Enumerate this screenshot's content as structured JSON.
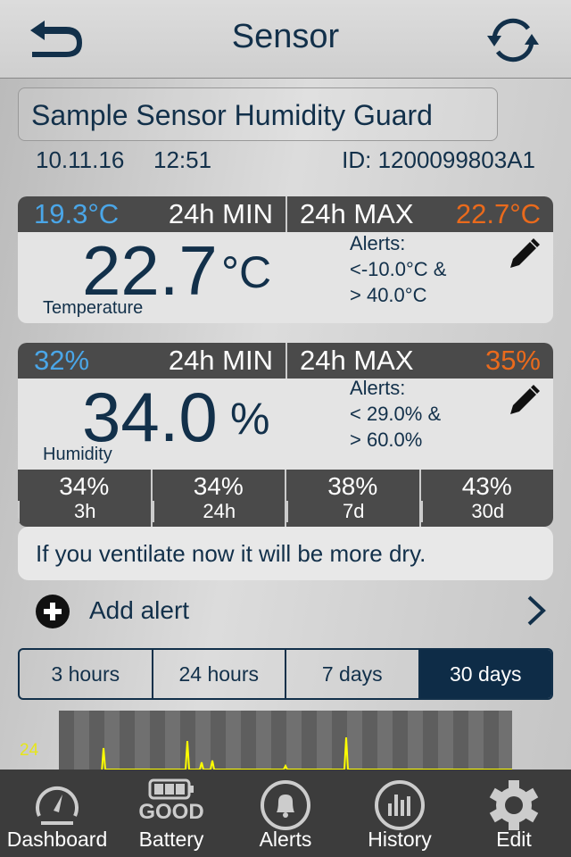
{
  "header": {
    "title": "Sensor",
    "back_icon": "back-arrow-icon",
    "refresh_icon": "refresh-icon"
  },
  "sensor": {
    "name": "Sample Sensor Humidity Guard",
    "date": "10.11.16",
    "time": "12:51",
    "id": "ID: 1200099803A1"
  },
  "temperature": {
    "min": "19.3°C",
    "min_label": "24h MIN",
    "max_label": "24h MAX",
    "max": "22.7°C",
    "value": "22.7",
    "unit": "°C",
    "label": "Temperature",
    "alerts_title": "Alerts:",
    "alerts_line1": "<-10.0°C &",
    "alerts_line2": "> 40.0°C"
  },
  "humidity": {
    "min": "32%",
    "min_label": "24h MIN",
    "max_label": "24h MAX",
    "max": "35%",
    "value": "34.0",
    "unit": "%",
    "label": "Humidity",
    "alerts_title": "Alerts:",
    "alerts_line1": "< 29.0% &",
    "alerts_line2": "> 60.0%",
    "averages": [
      {
        "value": "34%",
        "period": "3h"
      },
      {
        "value": "34%",
        "period": "24h"
      },
      {
        "value": "38%",
        "period": "7d"
      },
      {
        "value": "43%",
        "period": "30d"
      }
    ]
  },
  "tip": "If you ventilate now it will be more dry.",
  "add_alert": "Add alert",
  "ranges": [
    {
      "label": "3 hours",
      "selected": false
    },
    {
      "label": "24 hours",
      "selected": false
    },
    {
      "label": "7 days",
      "selected": false
    },
    {
      "label": "30 days",
      "selected": true
    }
  ],
  "chart": {
    "y_tick": "24",
    "line_color": "#ffff00"
  },
  "colors": {
    "min": "#4aa6e8",
    "max": "#ea6a1c",
    "primary": "#12304a"
  },
  "tabbar": {
    "items": [
      {
        "label": "Dashboard",
        "icon": "speedometer-icon"
      },
      {
        "label": "Battery",
        "icon": "battery-icon",
        "status": "GOOD"
      },
      {
        "label": "Alerts",
        "icon": "bell-icon"
      },
      {
        "label": "History",
        "icon": "bar-chart-icon"
      },
      {
        "label": "Edit",
        "icon": "gear-icon"
      }
    ]
  }
}
